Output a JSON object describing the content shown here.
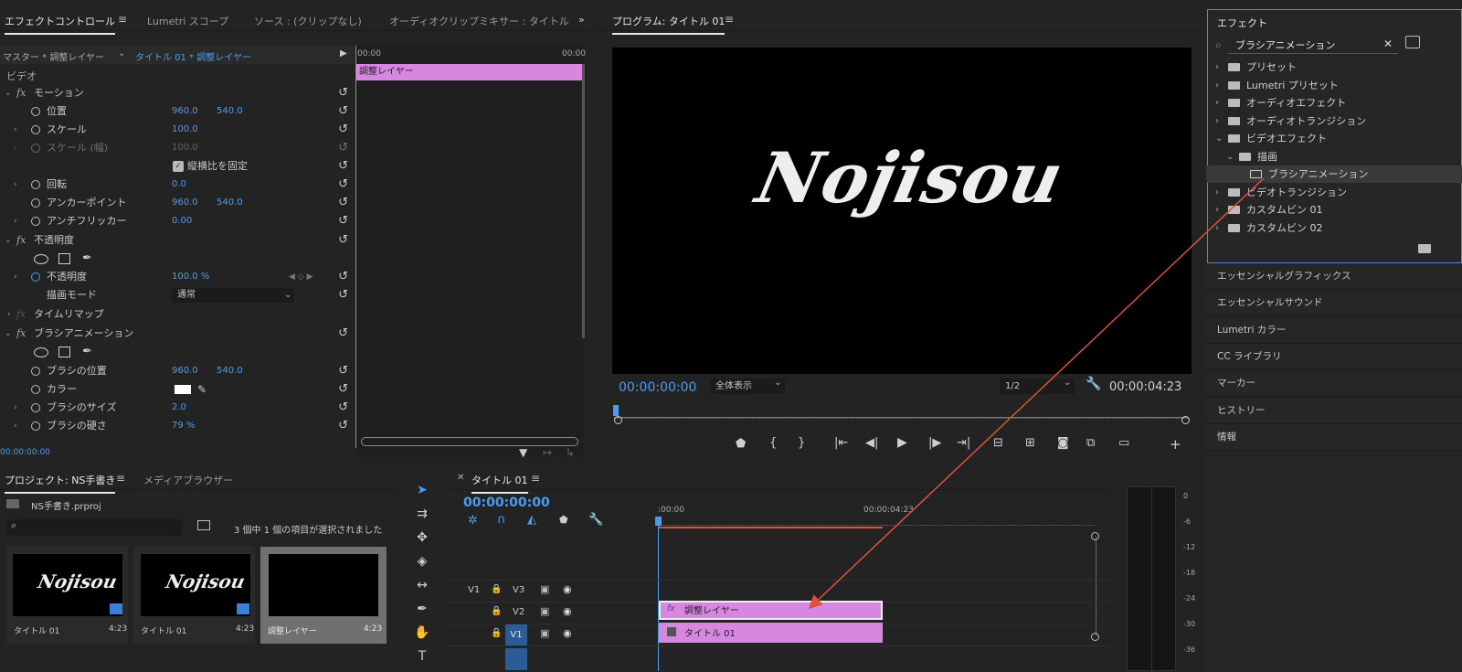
{
  "colors": {
    "accent": "#4b9cf0",
    "clip": "#d887e0",
    "annotation": "#e0503a",
    "panelBg": "#232323"
  },
  "effectControls": {
    "tabs": [
      "エフェクトコントロール",
      "Lumetri スコープ",
      "ソース : (クリップなし)",
      "オーディオクリップミキサー : タイトル"
    ],
    "master": "マスター * 調整レイヤー",
    "clipName": "タイトル 01 * 調整レイヤー",
    "time_start": "00:00",
    "time_end": "00:00",
    "clipBar": "調整レイヤー",
    "section": "ビデオ",
    "rows": [
      {
        "label": "モーション",
        "kind": "fx"
      },
      {
        "label": "位置",
        "v1": "960.0",
        "v2": "540.0"
      },
      {
        "label": "スケール",
        "v1": "100.0"
      },
      {
        "label": "スケール (幅)",
        "v1": "100.0"
      },
      {
        "label": "縦横比を固定",
        "kind": "check"
      },
      {
        "label": "回転",
        "v1": "0.0"
      },
      {
        "label": "アンカーポイント",
        "v1": "960.0",
        "v2": "540.0"
      },
      {
        "label": "アンチフリッカー",
        "v1": "0.00"
      },
      {
        "label": "不透明度",
        "kind": "fx"
      },
      {
        "label": "",
        "kind": "shapes"
      },
      {
        "label": "不透明度",
        "v1": "100.0 %"
      },
      {
        "label": "描画モード",
        "v1": "通常"
      },
      {
        "label": "タイムリマップ",
        "kind": "fx"
      },
      {
        "label": "ブラシアニメーション",
        "kind": "fx"
      },
      {
        "label": "",
        "kind": "shapes"
      },
      {
        "label": "ブラシの位置",
        "v1": "960.0",
        "v2": "540.0"
      },
      {
        "label": "カラー",
        "kind": "color"
      },
      {
        "label": "ブラシのサイズ",
        "v1": "2.0"
      },
      {
        "label": "ブラシの硬さ",
        "v1": "79 %"
      }
    ],
    "timecode": "00:00:00:00"
  },
  "program": {
    "title": "プログラム: タイトル 01",
    "frameText": "Nojisou",
    "timecode": "00:00:00:00",
    "fit": "全体表示",
    "resolution": "1/2",
    "duration": "00:00:04:23"
  },
  "effects": {
    "title": "エフェクト",
    "search": "ブラシアニメーション",
    "items": [
      {
        "label": "プリセット",
        "level": 0,
        "open": false
      },
      {
        "label": "Lumetri プリセット",
        "level": 0,
        "open": false
      },
      {
        "label": "オーディオエフェクト",
        "level": 0,
        "open": false
      },
      {
        "label": "オーディオトランジション",
        "level": 0,
        "open": false
      },
      {
        "label": "ビデオエフェクト",
        "level": 0,
        "open": true
      },
      {
        "label": "描画",
        "level": 1,
        "open": true
      },
      {
        "label": "ブラシアニメーション",
        "level": 2,
        "selected": true
      },
      {
        "label": "ビデオトランジション",
        "level": 0,
        "open": false
      },
      {
        "label": "カスタムビン 01",
        "level": 0,
        "open": false
      },
      {
        "label": "カスタムビン 02",
        "level": 0,
        "open": false
      }
    ],
    "panels": [
      "エッセンシャルグラフィックス",
      "エッセンシャルサウンド",
      "Lumetri カラー",
      "CC ライブラリ",
      "マーカー",
      "ヒストリー",
      "情報"
    ]
  },
  "project": {
    "tabs": [
      "プロジェクト: NS手書き",
      "メディアブラウザー"
    ],
    "file": "NS手書き.prproj",
    "selection": "3 個中 1 個の項目が選択されました",
    "items": [
      {
        "name": "タイトル 01",
        "dur": "4:23"
      },
      {
        "name": "タイトル 01",
        "dur": "4:23"
      },
      {
        "name": "調整レイヤー",
        "dur": "4:23"
      }
    ]
  },
  "timeline": {
    "title": "タイトル 01",
    "timecode": "00:00:00:00",
    "ruler_start": ":00:00",
    "ruler_end": "00:00:04:23",
    "tracks": [
      "V3",
      "V2",
      "V1"
    ],
    "source": "V1",
    "clips": [
      "調整レイヤー",
      "タイトル 01"
    ]
  },
  "meter": {
    "ticks": [
      "0",
      "-6",
      "-12",
      "-18",
      "-24",
      "-30",
      "-36"
    ]
  }
}
